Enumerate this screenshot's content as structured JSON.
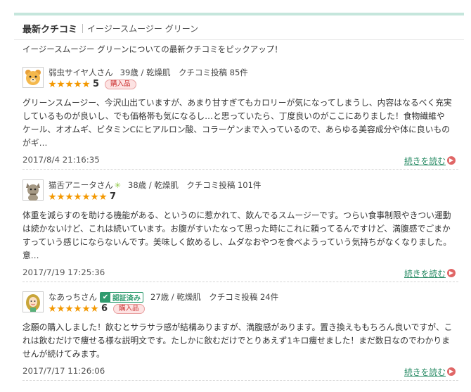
{
  "header": {
    "title": "最新クチコミ",
    "product": "イージースムージー グリーン"
  },
  "intro": "イージースムージー グリーンについての最新クチコミをピックアップ！",
  "reviews": [
    {
      "name": "弱虫サイヤ人さん",
      "meta": "39歳 / 乾燥肌　クチコミ投稿 85件",
      "stars": 5,
      "score": "5",
      "badge": "購入品",
      "body": "グリーンスムージー、今沢山出ていますが、あまり甘すぎてもカロリーが気になってしまうし、内容はなるべく充実しているものが良いし、でも価格帯も気になるし…と思っていたら、丁度良いのがここにありました！食物繊維やケール、オオムギ、ビタミンCにヒアルロン酸、コラーゲンまで入っているので、あらゆる美容成分や体に良いものがギ…",
      "date": "2017/8/4 21:16:35",
      "more": "続きを読む"
    },
    {
      "name": "猫舌アニータさん",
      "meta": "38歳 / 乾燥肌　クチコミ投稿 101件",
      "stars": 7,
      "score": "7",
      "body": "体重を減らすのを助ける機能がある、というのに惹かれて、飲んでるスムージーです。つらい食事制限やきつい運動は続かないけど、これは続いています。お腹がすいたなって思った時にこれに頼ってるんですけど、満腹感でごまかすっていう感じにならないんです。美味しく飲めるし、ムダなおやつを食べようっていう気持ちがなくなりました。意…",
      "date": "2017/7/19 17:25:36",
      "more": "続きを読む"
    },
    {
      "name": "なあっちさん",
      "verified": "認証済み",
      "meta": "27歳 / 乾燥肌　クチコミ投稿 24件",
      "stars": 6,
      "score": "6",
      "badge": "購入品",
      "body": "念願の購入しました！飲むとサラサラ感が結構ありますが、満腹感があります。置き換えももちろん良いですが、これは飲むだけで痩せる様な説明文です。たしかに飲むだけでとりあえず1キロ痩せました！まだ数日なのでわかりませんが続けてみます。",
      "date": "2017/7/17 11:26:06",
      "more": "続きを読む"
    }
  ]
}
